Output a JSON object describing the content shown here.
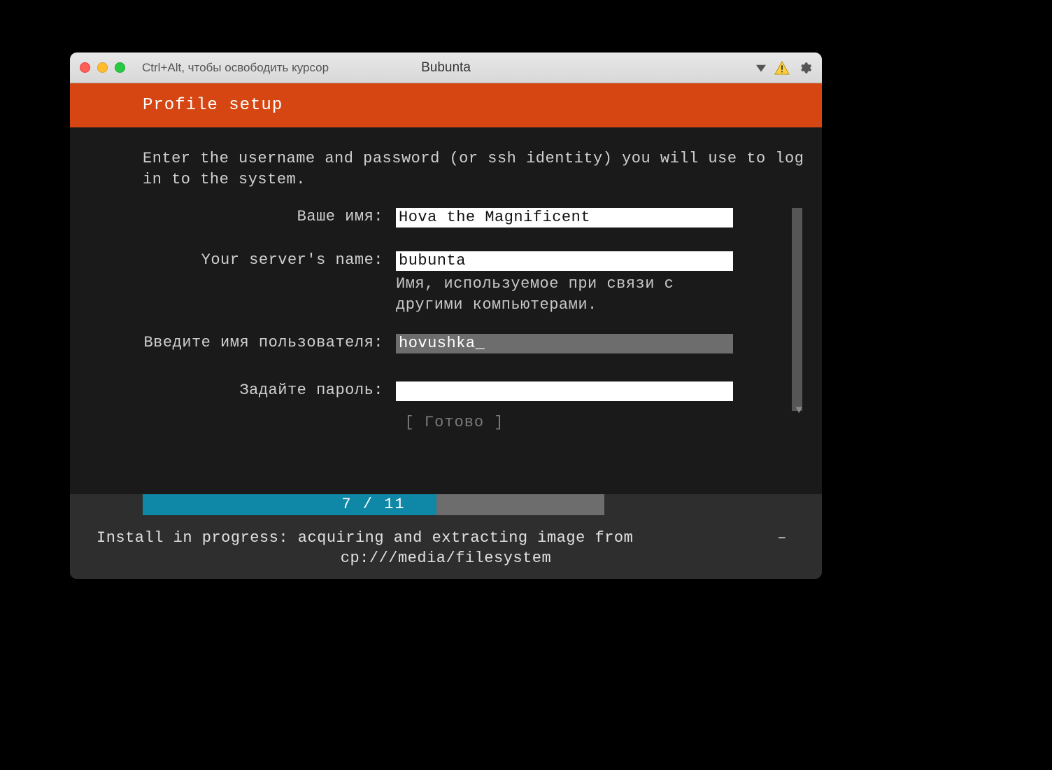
{
  "titlebar": {
    "hint": "Ctrl+Alt, чтобы освободить курсор",
    "vm_name": "Bubunta"
  },
  "header": {
    "title": "Profile setup"
  },
  "description": "Enter the username and password (or ssh identity) you will use to log in to the system.",
  "form": {
    "your_name_label": "Ваше имя:",
    "your_name_value": "Hova the Magnificent",
    "server_name_label": "Your server's name:",
    "server_name_value": "bubunta",
    "server_name_hint": "Имя, используемое при связи с другими компьютерами.",
    "username_label": "Введите имя пользователя:",
    "username_value": "hovushka",
    "password_label": "Задайте пароль:",
    "password_value": ""
  },
  "done_button": "[ Готово      ]",
  "progress": {
    "current": 7,
    "total": 11,
    "text": "7 / 11",
    "percent": 63.6
  },
  "install": {
    "line1": "Install in progress: acquiring and extracting image from",
    "spinner": "–",
    "line2": "cp:///media/filesystem"
  }
}
